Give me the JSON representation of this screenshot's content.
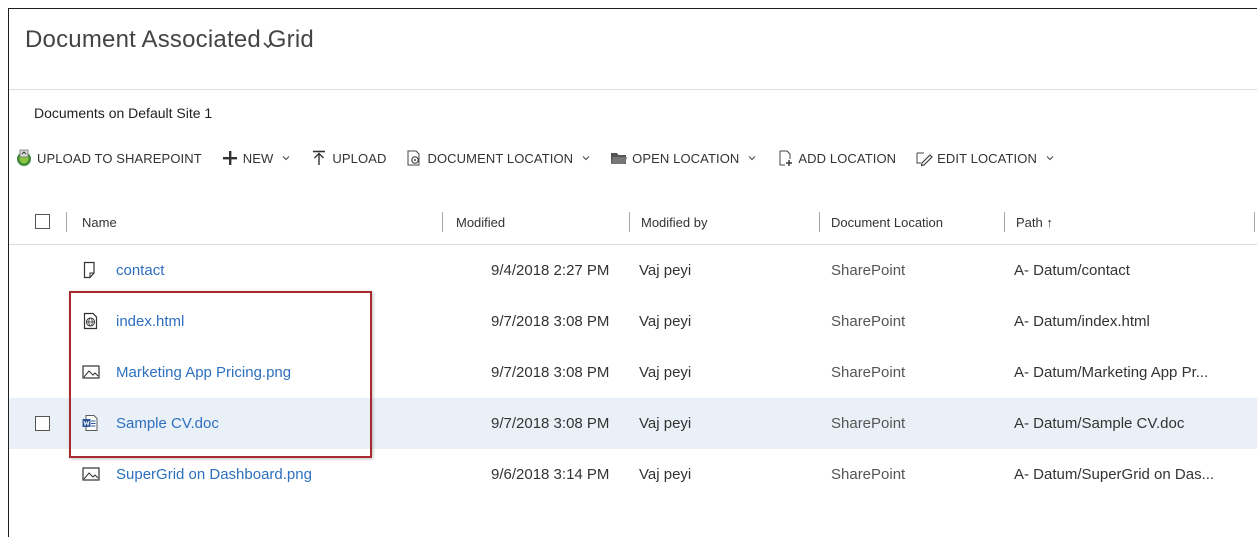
{
  "header": {
    "title": "Document Associated Grid",
    "subtitle": "Documents on Default Site 1"
  },
  "toolbar": {
    "buttons": [
      {
        "label": "UPLOAD TO SHAREPOINT",
        "icon": "sharepoint-upload-icon"
      },
      {
        "label": "NEW",
        "icon": "plus-icon",
        "dropdown": true
      },
      {
        "label": "UPLOAD",
        "icon": "upload-arrow-icon"
      },
      {
        "label": "DOCUMENT LOCATION",
        "icon": "document-location-icon",
        "dropdown": true
      },
      {
        "label": "OPEN LOCATION",
        "icon": "folder-open-icon",
        "dropdown": true
      },
      {
        "label": "ADD LOCATION",
        "icon": "add-location-icon"
      },
      {
        "label": "EDIT LOCATION",
        "icon": "edit-location-icon",
        "dropdown": true
      }
    ]
  },
  "grid": {
    "columns": {
      "name": "Name",
      "modified": "Modified",
      "modified_by": "Modified by",
      "document_location": "Document Location",
      "path": "Path ↑"
    },
    "rows": [
      {
        "icon": "blank-document-icon",
        "name": "contact",
        "modified": "9/4/2018 2:27 PM",
        "modified_by": "Vaj peyi",
        "location": "SharePoint",
        "path": "A- Datum/contact"
      },
      {
        "icon": "web-document-icon",
        "name": "index.html",
        "modified": "9/7/2018 3:08 PM",
        "modified_by": "Vaj peyi",
        "location": "SharePoint",
        "path": "A- Datum/index.html"
      },
      {
        "icon": "image-document-icon",
        "name": "Marketing App Pricing.png",
        "modified": "9/7/2018 3:08 PM",
        "modified_by": "Vaj peyi",
        "location": "SharePoint",
        "path": "A- Datum/Marketing App Pr..."
      },
      {
        "icon": "word-document-icon",
        "name": "Sample CV.doc",
        "modified": "9/7/2018 3:08 PM",
        "modified_by": "Vaj peyi",
        "location": "SharePoint",
        "path": "A- Datum/Sample CV.doc"
      },
      {
        "icon": "image-document-icon",
        "name": "SuperGrid on Dashboard.png",
        "modified": "9/6/2018 3:14 PM",
        "modified_by": "Vaj peyi",
        "location": "SharePoint",
        "path": "A- Datum/SuperGrid on Das..."
      }
    ]
  },
  "colors": {
    "link": "#2e6fbf",
    "selected_row": "#eaf0f7",
    "highlight_border": "#a72a31"
  }
}
